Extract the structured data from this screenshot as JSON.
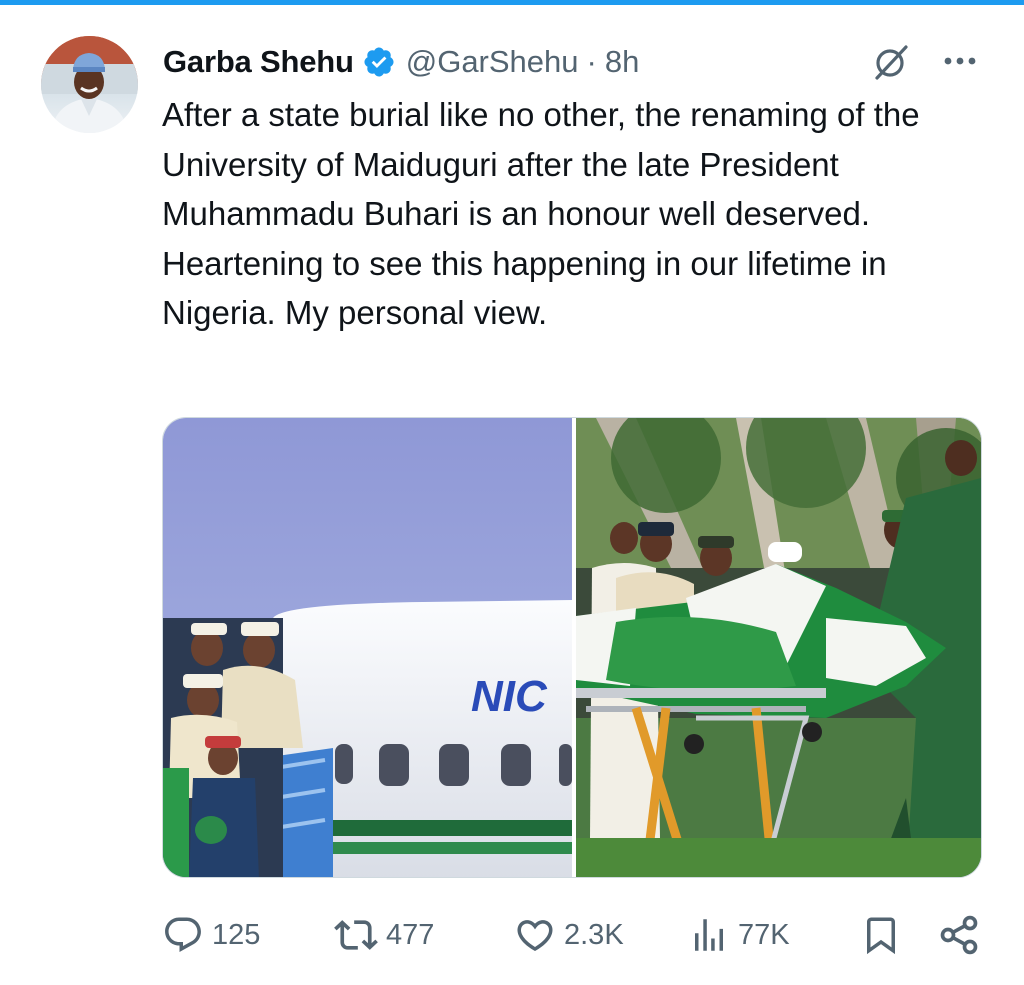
{
  "tweet": {
    "author_name": "Garba Shehu",
    "handle": "@GarShehu",
    "separator": "·",
    "time": "8h",
    "verified": true,
    "paragraphs": [
      "After a state burial like no other, the renaming of the University of Maiduguri after the late President Muhammadu Buhari is an honour well deserved.",
      "Heartening to see this happening in our lifetime in Nigeria. My personal view."
    ],
    "media": {
      "left_photo_text": "NIC"
    }
  },
  "actions": {
    "replies": "125",
    "reposts": "477",
    "likes": "2.3K",
    "views": "77K"
  },
  "icons": {
    "verified": "verified-badge-icon",
    "grok": "grok-icon",
    "more": "more-icon",
    "reply": "reply-icon",
    "repost": "repost-icon",
    "like": "heart-icon",
    "views": "views-icon",
    "bookmark": "bookmark-icon",
    "share": "share-icon"
  },
  "colors": {
    "accent": "#1d9bf0",
    "secondary_text": "#536471",
    "primary_text": "#0f1419"
  }
}
